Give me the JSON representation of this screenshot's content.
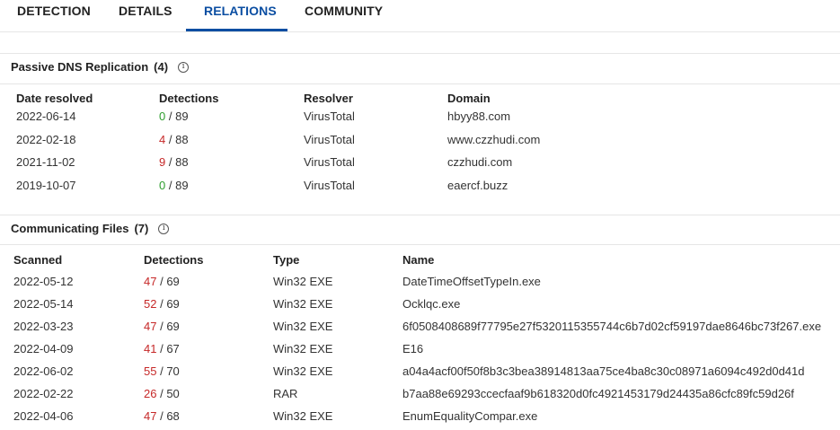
{
  "tabs": [
    {
      "label": "DETECTION"
    },
    {
      "label": "DETAILS"
    },
    {
      "label": "RELATIONS"
    },
    {
      "label": "COMMUNITY"
    }
  ],
  "colors": {
    "accent": "#0b4ea2",
    "clean": "#2e9e2e",
    "malicious": "#c62828"
  },
  "passive_dns": {
    "title": "Passive DNS Replication",
    "count": "(4)",
    "headers": {
      "date": "Date resolved",
      "detections": "Detections",
      "resolver": "Resolver",
      "domain": "Domain"
    },
    "rows": [
      {
        "date": "2022-06-14",
        "det": "0",
        "total": "/ 89",
        "status": "good",
        "resolver": "VirusTotal",
        "domain": "hbyy88.com"
      },
      {
        "date": "2022-02-18",
        "det": "4",
        "total": "/ 88",
        "status": "bad",
        "resolver": "VirusTotal",
        "domain": "www.czzhudi.com"
      },
      {
        "date": "2021-11-02",
        "det": "9",
        "total": "/ 88",
        "status": "bad",
        "resolver": "VirusTotal",
        "domain": "czzhudi.com"
      },
      {
        "date": "2019-10-07",
        "det": "0",
        "total": "/ 89",
        "status": "good",
        "resolver": "VirusTotal",
        "domain": "eaercf.buzz"
      }
    ]
  },
  "communicating_files": {
    "title": "Communicating Files",
    "count": "(7)",
    "headers": {
      "scanned": "Scanned",
      "detections": "Detections",
      "type": "Type",
      "name": "Name"
    },
    "rows": [
      {
        "scanned": "2022-05-12",
        "det": "47",
        "total": "/ 69",
        "type": "Win32 EXE",
        "name": "DateTimeOffsetTypeIn.exe"
      },
      {
        "scanned": "2022-05-14",
        "det": "52",
        "total": "/ 69",
        "type": "Win32 EXE",
        "name": "Ocklqc.exe"
      },
      {
        "scanned": "2022-03-23",
        "det": "47",
        "total": "/ 69",
        "type": "Win32 EXE",
        "name": "6f0508408689f77795e27f5320115355744c6b7d02cf59197dae8646bc73f267.exe"
      },
      {
        "scanned": "2022-04-09",
        "det": "41",
        "total": "/ 67",
        "type": "Win32 EXE",
        "name": "E16"
      },
      {
        "scanned": "2022-06-02",
        "det": "55",
        "total": "/ 70",
        "type": "Win32 EXE",
        "name": "a04a4acf00f50f8b3c3bea38914813aa75ce4ba8c30c08971a6094c492d0d41d"
      },
      {
        "scanned": "2022-02-22",
        "det": "26",
        "total": "/ 50",
        "type": "RAR",
        "name": "b7aa88e69293ccecfaaf9b618320d0fc4921453179d24435a86cfc89fc59d26f"
      },
      {
        "scanned": "2022-04-06",
        "det": "47",
        "total": "/ 68",
        "type": "Win32 EXE",
        "name": "EnumEqualityCompar.exe"
      }
    ]
  }
}
